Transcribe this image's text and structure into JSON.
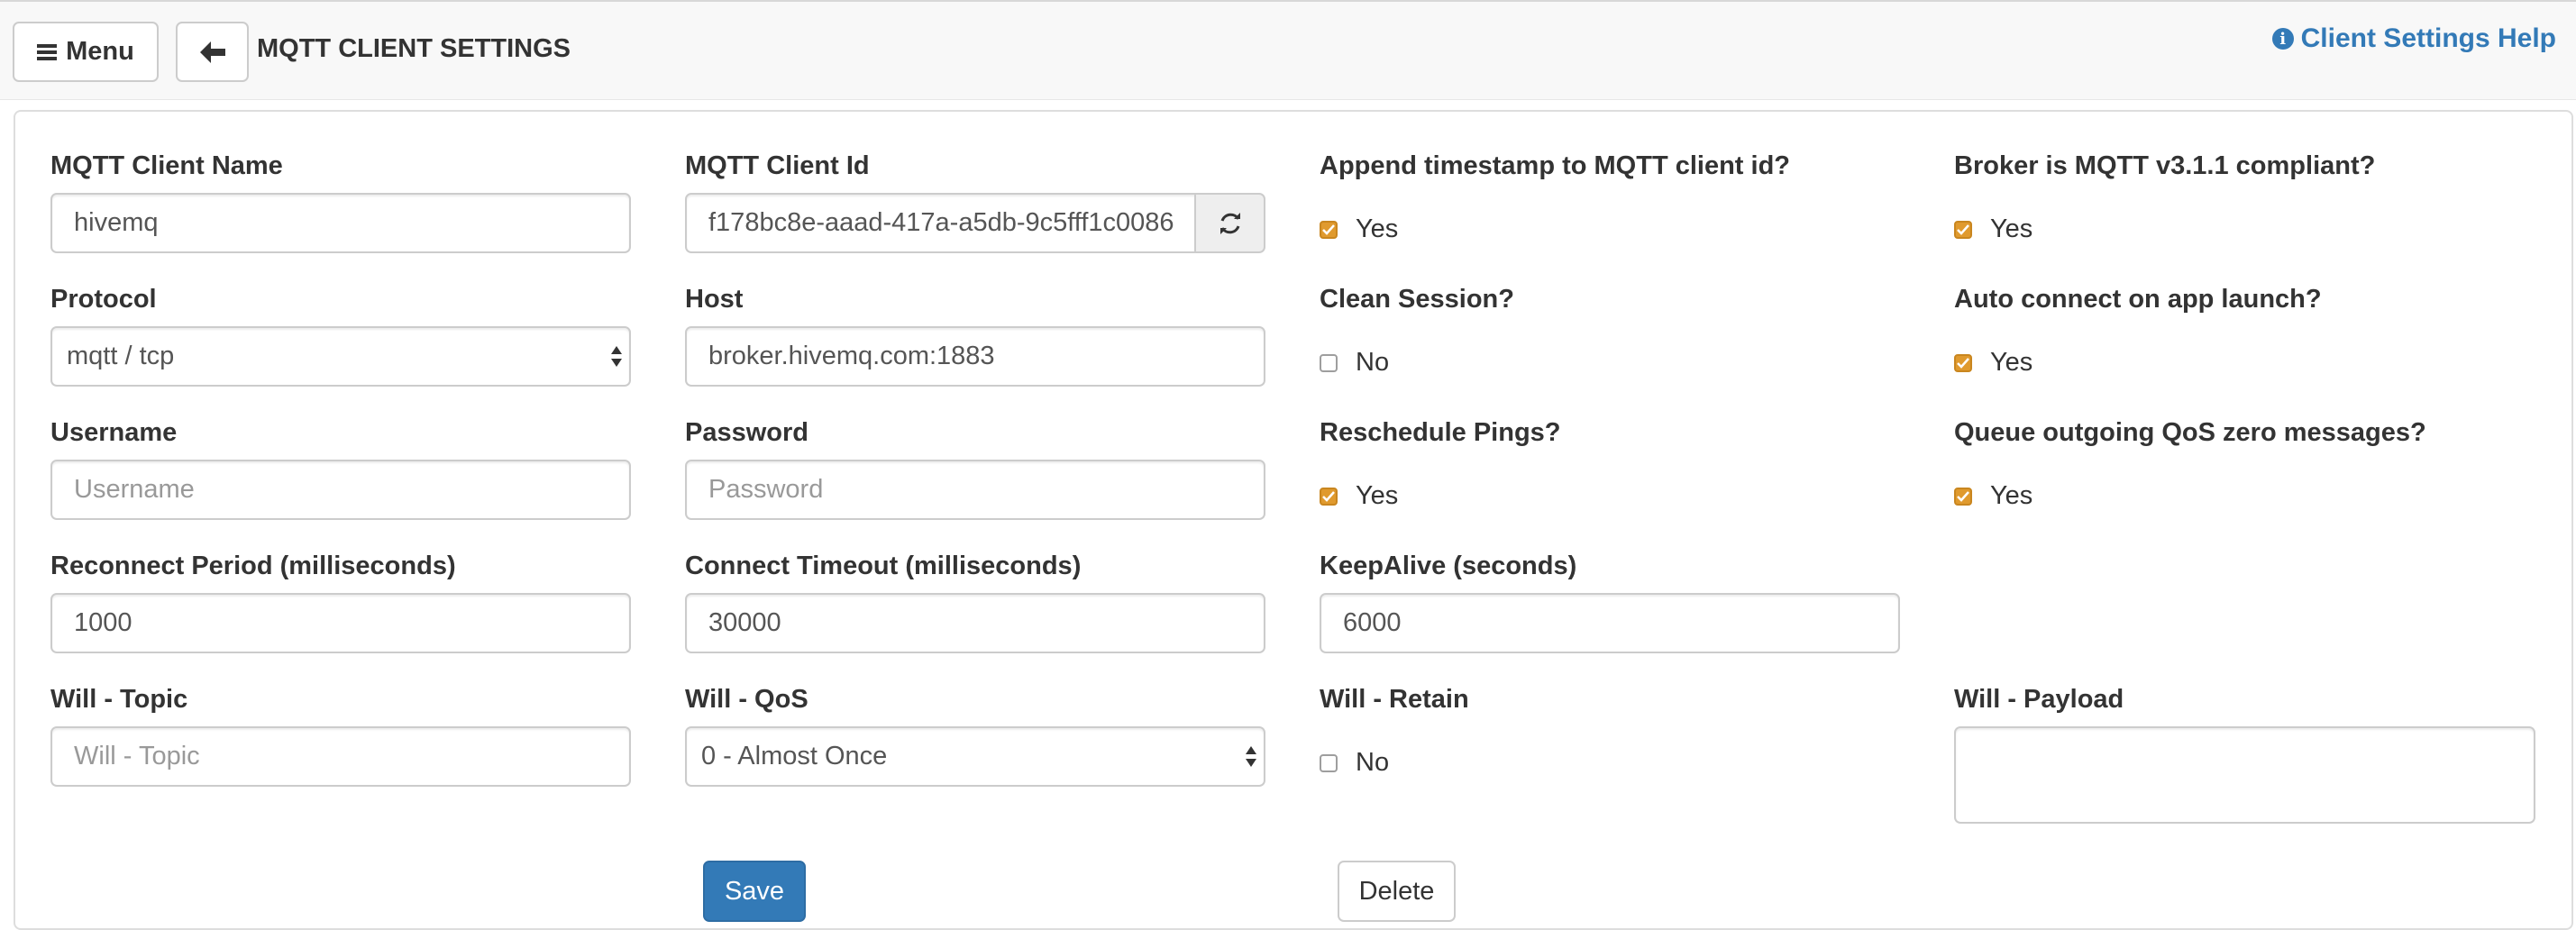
{
  "header": {
    "menu_label": "Menu",
    "back_icon": "arrow-left-icon",
    "title": "MQTT CLIENT SETTINGS",
    "help_label": "Client Settings Help",
    "help_icon": "info-circle-icon",
    "link_color": "#337ab7"
  },
  "form": {
    "client_name": {
      "label": "MQTT Client Name",
      "value": "hivemq"
    },
    "client_id": {
      "label": "MQTT Client Id",
      "value": "f178bc8e-aaad-417a-a5db-9c5fff1c0086",
      "refresh_icon": "refresh-icon"
    },
    "append_timestamp": {
      "label": "Append timestamp to MQTT client id?",
      "checked": true,
      "text": "Yes"
    },
    "broker_compliant": {
      "label": "Broker is MQTT v3.1.1 compliant?",
      "checked": true,
      "text": "Yes"
    },
    "protocol": {
      "label": "Protocol",
      "value": "mqtt / tcp"
    },
    "host": {
      "label": "Host",
      "value": "broker.hivemq.com:1883"
    },
    "clean_session": {
      "label": "Clean Session?",
      "checked": false,
      "text": "No"
    },
    "auto_connect": {
      "label": "Auto connect on app launch?",
      "checked": true,
      "text": "Yes"
    },
    "username": {
      "label": "Username",
      "placeholder": "Username"
    },
    "password": {
      "label": "Password",
      "placeholder": "Password"
    },
    "reschedule_pings": {
      "label": "Reschedule Pings?",
      "checked": true,
      "text": "Yes"
    },
    "queue_qos_zero": {
      "label": "Queue outgoing QoS zero messages?",
      "checked": true,
      "text": "Yes"
    },
    "reconnect_period": {
      "label": "Reconnect Period (milliseconds)",
      "value": "1000"
    },
    "connect_timeout": {
      "label": "Connect Timeout (milliseconds)",
      "value": "30000"
    },
    "keepalive": {
      "label": "KeepAlive (seconds)",
      "value": "6000"
    },
    "will_topic": {
      "label": "Will - Topic",
      "placeholder": "Will - Topic"
    },
    "will_qos": {
      "label": "Will - QoS",
      "value": "0 - Almost Once"
    },
    "will_retain": {
      "label": "Will - Retain",
      "checked": false,
      "text": "No"
    },
    "will_payload": {
      "label": "Will - Payload",
      "value": ""
    }
  },
  "actions": {
    "save_label": "Save",
    "delete_label": "Delete",
    "primary_color": "#337ab7",
    "checkbox_color": "#e09a2e"
  }
}
